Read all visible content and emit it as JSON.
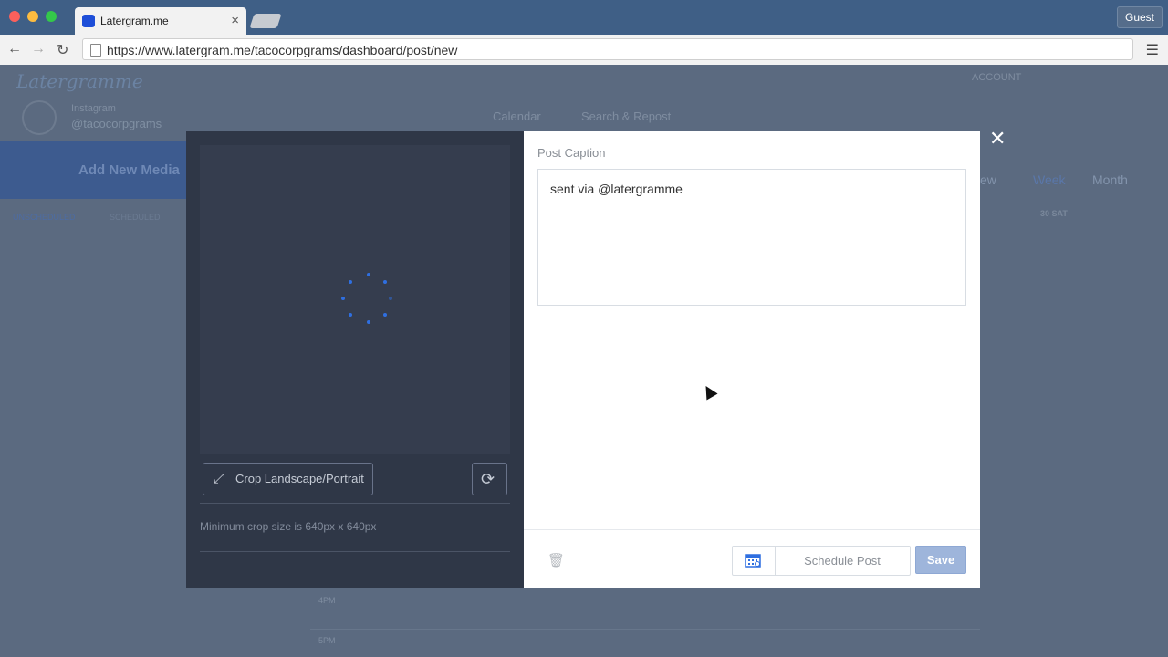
{
  "browser": {
    "tab_title": "Latergram.me",
    "url": "https://www.latergram.me/tacocorpgrams/dashboard/post/new",
    "guest_label": "Guest",
    "traffic_colors": [
      "#fc605c",
      "#fdbc40",
      "#34c84a"
    ]
  },
  "app": {
    "logo": "Latergramme",
    "account_label": "ACCOUNT",
    "profile": {
      "network": "Instagram",
      "handle": "@tacocorpgrams"
    },
    "nav": [
      "Calendar",
      "Search & Repost"
    ],
    "banner": "Add New Media",
    "side_tabs": [
      "UNSCHEDULED",
      "SCHEDULED"
    ],
    "view_tabs": [
      "ew",
      "Week",
      "Month"
    ],
    "calendar_day": "30 SAT",
    "time_labels": [
      "4PM",
      "5PM"
    ]
  },
  "modal": {
    "crop_button": "Crop Landscape/Portrait",
    "min_crop_text": "Minimum crop size is 640px x 640px",
    "caption_label": "Post Caption",
    "caption_value": "sent via @latergramme",
    "schedule_label": "Schedule Post",
    "save_label": "Save",
    "close_symbol": "✕"
  },
  "icons": {
    "crop": "crop-expand-icon",
    "rotate": "rotate-icon",
    "trash": "trash-icon",
    "calendar": "calendar-icon",
    "spinner": "loading-spinner-icon"
  },
  "colors": {
    "accent": "#2f6fe0",
    "save_button": "#9eb5db",
    "modal_left_bg": "#2f3747"
  }
}
